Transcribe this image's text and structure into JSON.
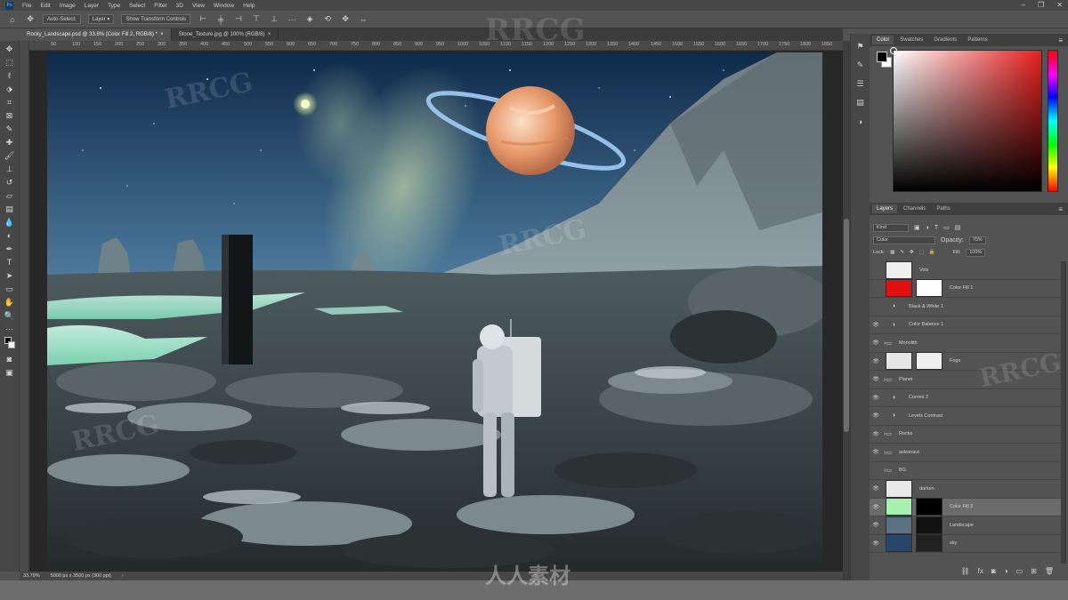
{
  "menu": {
    "items": [
      "File",
      "Edit",
      "Image",
      "Layer",
      "Type",
      "Select",
      "Filter",
      "3D",
      "View",
      "Window",
      "Help"
    ]
  },
  "options_bar": {
    "auto_select_label": "Auto-Select:",
    "auto_select_value": "Layer",
    "show_transform_label": "Show Transform Controls"
  },
  "tabs": [
    {
      "label": "Rocky_Landscape.psd @ 33.8% (Color Fill 2, RGB/8) *",
      "active": true
    },
    {
      "label": "Stone_Texture.jpg @ 100% (RGB/8)",
      "active": false
    }
  ],
  "ruler_marks": [
    "50",
    "100",
    "150",
    "200",
    "250",
    "300",
    "350",
    "400",
    "450",
    "500",
    "550",
    "600",
    "650",
    "700",
    "750",
    "800",
    "850",
    "900",
    "950",
    "1000",
    "1050",
    "1100",
    "1150",
    "1200",
    "1250",
    "1300",
    "1350",
    "1400",
    "1450",
    "1500",
    "1550",
    "1600",
    "1650",
    "1700",
    "1750",
    "1800",
    "1850"
  ],
  "status": {
    "zoom": "33.79%",
    "doc_size": "5000 px x 3500 px (300 ppi)"
  },
  "color_panel": {
    "tabs": [
      "Color",
      "Swatches",
      "Gradients",
      "Patterns"
    ],
    "foreground": "#000000",
    "background": "#ffffff",
    "hue_color": "#e81f1f"
  },
  "layers_panel": {
    "tabs": [
      "Layers",
      "Channels",
      "Paths"
    ],
    "filter_kind": "Kind",
    "blend_mode": "Color",
    "opacity_label": "Opacity:",
    "opacity_value": "70%",
    "lock_label": "Lock:",
    "fill_label": "Fill:",
    "fill_value": "100%",
    "layers": [
      {
        "name": "Vols",
        "thumb": "#eeeeee",
        "eye": false
      },
      {
        "name": "Color Fill 1",
        "thumb": "#e01010",
        "eye": false,
        "mask": "#ffffff"
      },
      {
        "name": "Black & White 1",
        "thumb": "",
        "eye": false
      },
      {
        "name": "Color Balance 1",
        "thumb": "",
        "eye": true
      },
      {
        "name": "Monolith",
        "thumb": "",
        "eye": true,
        "folder": true
      },
      {
        "name": "Fogs",
        "thumb": "#e6e6e6",
        "eye": true,
        "mask": "#eeeeee"
      },
      {
        "name": "Planet",
        "thumb": "",
        "eye": true,
        "folder": true
      },
      {
        "name": "Curves 2",
        "thumb": "",
        "eye": true
      },
      {
        "name": "Levels Contrast",
        "thumb": "",
        "eye": true
      },
      {
        "name": "Rocks",
        "thumb": "",
        "eye": true,
        "folder": true
      },
      {
        "name": "astronaut",
        "thumb": "",
        "eye": true,
        "folder": true
      },
      {
        "name": "BG",
        "thumb": "",
        "eye": false,
        "folder": true
      },
      {
        "name": "darken",
        "thumb": "#e8e8e8",
        "eye": true
      },
      {
        "name": "Color Fill 2",
        "thumb": "#a6f0b0",
        "eye": true,
        "mask": "#000000",
        "selected": true
      },
      {
        "name": "Landscape",
        "thumb": "#5b7080",
        "eye": true,
        "mask": "#111111"
      },
      {
        "name": "sky",
        "thumb": "#27466a",
        "eye": true,
        "mask": "#222222"
      }
    ]
  },
  "watermark": {
    "text": "RRCG",
    "cn_text": "人人素材"
  }
}
